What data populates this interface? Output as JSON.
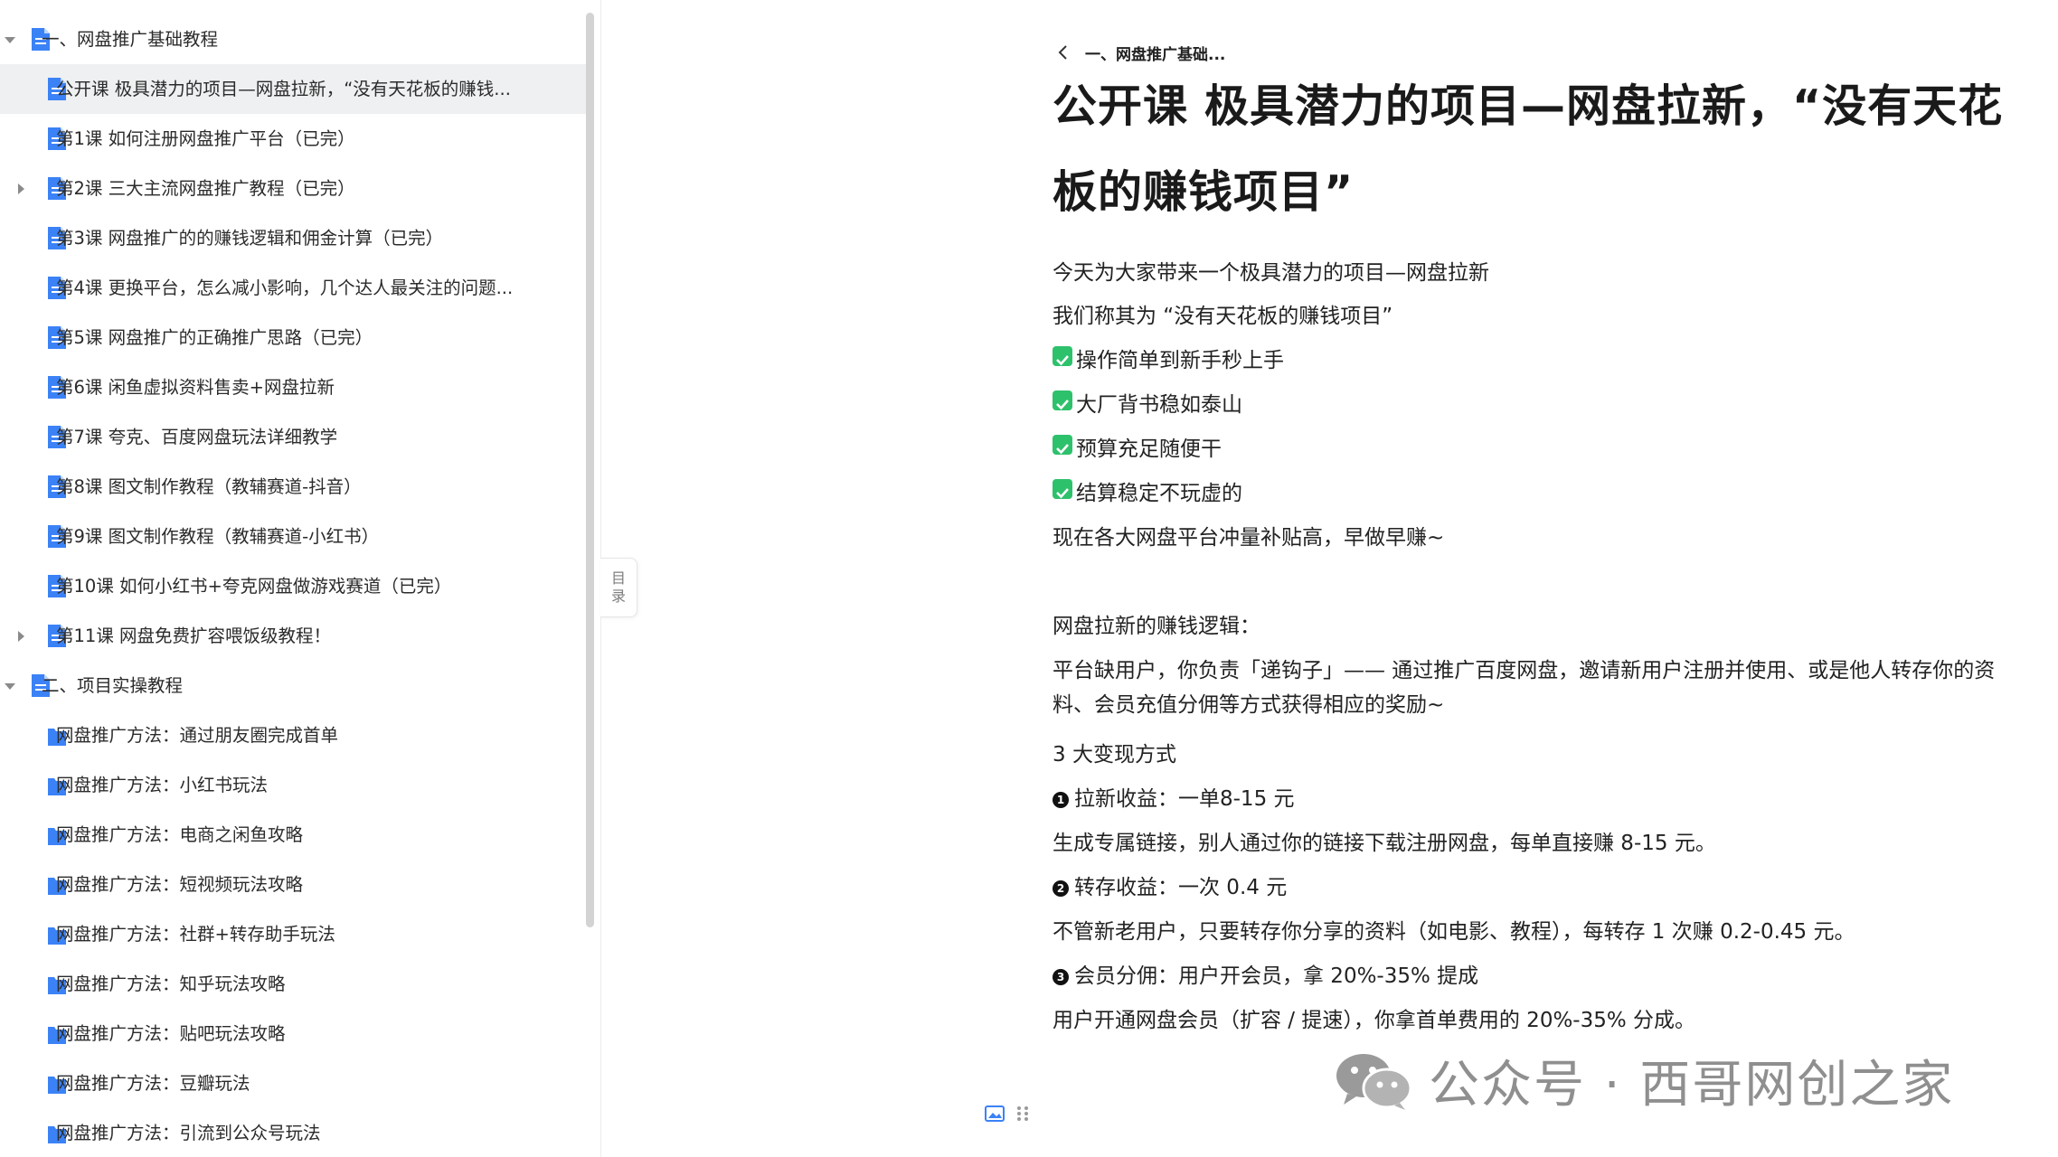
{
  "sidebar": {
    "items": [
      {
        "label": "一、网盘推广基础教程",
        "caret": "down",
        "level": 0,
        "icon": "doc-icon",
        "active": false
      },
      {
        "label": "公开课 极具潜力的项目—网盘拉新，“没有天花板的赚钱...",
        "caret": "",
        "level": 1,
        "icon": "doc-icon",
        "active": true
      },
      {
        "label": "第1课 如何注册网盘推广平台（已完）",
        "caret": "",
        "level": 1,
        "icon": "doc-icon",
        "active": false
      },
      {
        "label": "第2课 三大主流网盘推广教程（已完）",
        "caret": "right",
        "level": 1,
        "icon": "doc-icon",
        "active": false
      },
      {
        "label": "第3课 网盘推广的的赚钱逻辑和佣金计算（已完）",
        "caret": "",
        "level": 1,
        "icon": "doc-icon",
        "active": false
      },
      {
        "label": "第4课 更换平台，怎么减小影响，几个达人最关注的问题...",
        "caret": "",
        "level": 1,
        "icon": "doc-icon",
        "active": false
      },
      {
        "label": "第5课 网盘推广的正确推广思路（已完）",
        "caret": "",
        "level": 1,
        "icon": "doc-icon",
        "active": false
      },
      {
        "label": "第6课 闲鱼虚拟资料售卖+网盘拉新",
        "caret": "",
        "level": 1,
        "icon": "doc-icon",
        "active": false
      },
      {
        "label": "第7课 夸克、百度网盘玩法详细教学",
        "caret": "",
        "level": 1,
        "icon": "doc-icon",
        "active": false
      },
      {
        "label": "第8课 图文制作教程（教辅赛道-抖音）",
        "caret": "",
        "level": 1,
        "icon": "doc-icon",
        "active": false
      },
      {
        "label": "第9课 图文制作教程（教辅赛道-小红书）",
        "caret": "",
        "level": 1,
        "icon": "doc-icon",
        "active": false
      },
      {
        "label": "第10课 如何小红书+夸克网盘做游戏赛道（已完）",
        "caret": "",
        "level": 1,
        "icon": "doc-icon",
        "active": false
      },
      {
        "label": "第11课 网盘免费扩容喂饭级教程！",
        "caret": "right",
        "level": 1,
        "icon": "doc-icon",
        "active": false
      },
      {
        "label": "二、项目实操教程",
        "caret": "down",
        "level": 0,
        "icon": "doc-icon",
        "active": false
      },
      {
        "label": "网盘推广方法：通过朋友圈完成首单",
        "caret": "",
        "level": 1,
        "icon": "folder-icon",
        "active": false
      },
      {
        "label": "网盘推广方法：小红书玩法",
        "caret": "",
        "level": 1,
        "icon": "folder-icon",
        "active": false
      },
      {
        "label": "网盘推广方法：电商之闲鱼攻略",
        "caret": "",
        "level": 1,
        "icon": "folder-icon",
        "active": false
      },
      {
        "label": "网盘推广方法：短视频玩法攻略",
        "caret": "",
        "level": 1,
        "icon": "folder-icon",
        "active": false
      },
      {
        "label": "网盘推广方法：社群+转存助手玩法",
        "caret": "",
        "level": 1,
        "icon": "folder-icon",
        "active": false
      },
      {
        "label": "网盘推广方法：知乎玩法攻略",
        "caret": "",
        "level": 1,
        "icon": "folder-icon",
        "active": false
      },
      {
        "label": "网盘推广方法：贴吧玩法攻略",
        "caret": "",
        "level": 1,
        "icon": "folder-icon",
        "active": false
      },
      {
        "label": "网盘推广方法：豆瓣玩法",
        "caret": "",
        "level": 1,
        "icon": "folder-icon",
        "active": false
      },
      {
        "label": "网盘推广方法：引流到公众号玩法",
        "caret": "",
        "level": 1,
        "icon": "folder-icon",
        "active": false
      }
    ],
    "icon_color": "#3b82f6"
  },
  "toc_tab": {
    "line1": "目",
    "line2": "录"
  },
  "main": {
    "breadcrumb": "一、网盘推广基础...",
    "title": "公开课 极具潜力的项目—网盘拉新，“没有天花板的赚钱项目”",
    "intro1": "今天为大家带来一个极具潜力的项目—网盘拉新",
    "intro2": "我们称其为 “没有天花板的赚钱项目”",
    "checks": [
      "操作简单到新手秒上手",
      "大厂背书稳如泰山",
      "预算充足随便干",
      "结算稳定不玩虚的"
    ],
    "check_color": "#2ec16c",
    "now": "现在各大网盘平台冲量补贴高，早做早赚~",
    "logic_heading": "网盘拉新的赚钱逻辑：",
    "logic_body": "平台缺用户，你负责「递钩子」—— 通过推广百度网盘，邀请新用户注册并使用、或是他人转存你的资料、会员充值分佣等方式获得相应的奖励~",
    "ways_heading": "3 大变现方式",
    "way1_num": "1",
    "way1_title": "拉新收益：一单8-15 元",
    "way1_desc": "生成专属链接，别人通过你的链接下载注册网盘，每单直接赚 8-15 元。",
    "way2_num": "2",
    "way2_title": "转存收益：一次 0.4 元",
    "way2_desc": "不管新老用户，只要转存你分享的资料（如电影、教程），每转存 1 次赚 0.2-0.45 元。",
    "way3_num": "3",
    "way3_title": "会员分佣：用户开会员，拿 20%-35% 提成",
    "way3_desc": "用户开通网盘会员（扩容 / 提速），你拿首单费用的 20%-35% 分成。"
  },
  "watermark": {
    "text": "公众号 · 西哥网创之家"
  }
}
